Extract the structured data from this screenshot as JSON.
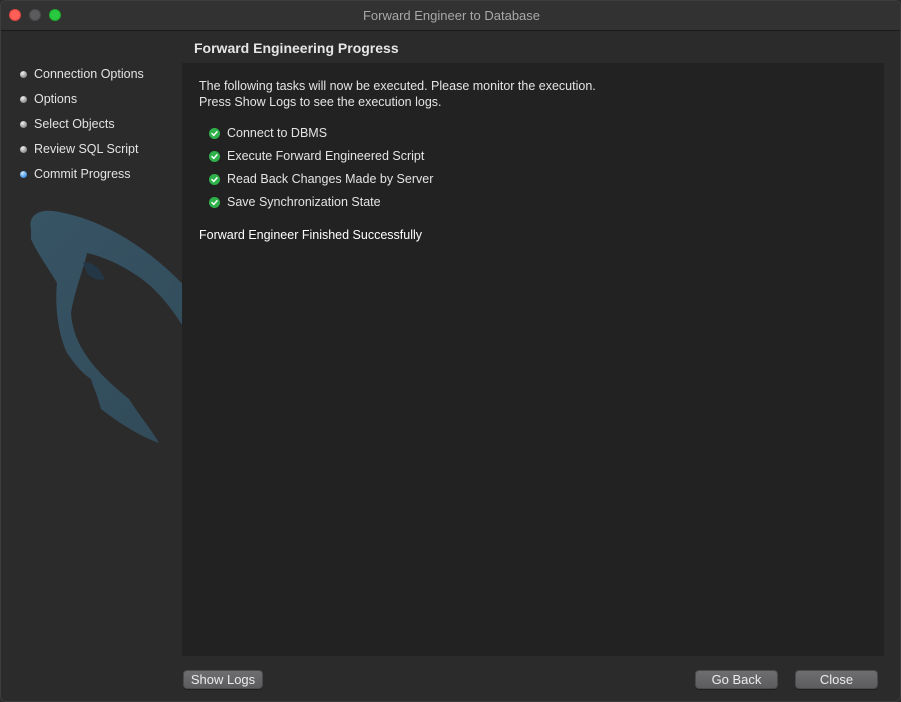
{
  "window": {
    "title": "Forward Engineer to Database"
  },
  "sidebar": {
    "steps": [
      {
        "label": "Connection Options",
        "state": "done"
      },
      {
        "label": "Options",
        "state": "done"
      },
      {
        "label": "Select Objects",
        "state": "done"
      },
      {
        "label": "Review SQL Script",
        "state": "done"
      },
      {
        "label": "Commit Progress",
        "state": "active"
      }
    ]
  },
  "main": {
    "heading": "Forward Engineering Progress",
    "intro_line1": "The following tasks will now be executed. Please monitor the execution.",
    "intro_line2": "Press Show Logs to see the execution logs.",
    "tasks": [
      {
        "label": "Connect to DBMS",
        "status": "success"
      },
      {
        "label": "Execute Forward Engineered Script",
        "status": "success"
      },
      {
        "label": "Read Back Changes Made by Server",
        "status": "success"
      },
      {
        "label": "Save Synchronization State",
        "status": "success"
      }
    ],
    "result": "Forward Engineer Finished Successfully"
  },
  "buttons": {
    "show_logs": "Show Logs",
    "go_back": "Go Back",
    "close": "Close"
  },
  "colors": {
    "success": "#2fb24a",
    "active_step": "#3f8fe0",
    "close_light": "#fe5f57",
    "maximize_light": "#28c840"
  },
  "icons": {
    "background": "mysql-dolphin-watermark",
    "task_status": "green-checkmark-icon"
  }
}
